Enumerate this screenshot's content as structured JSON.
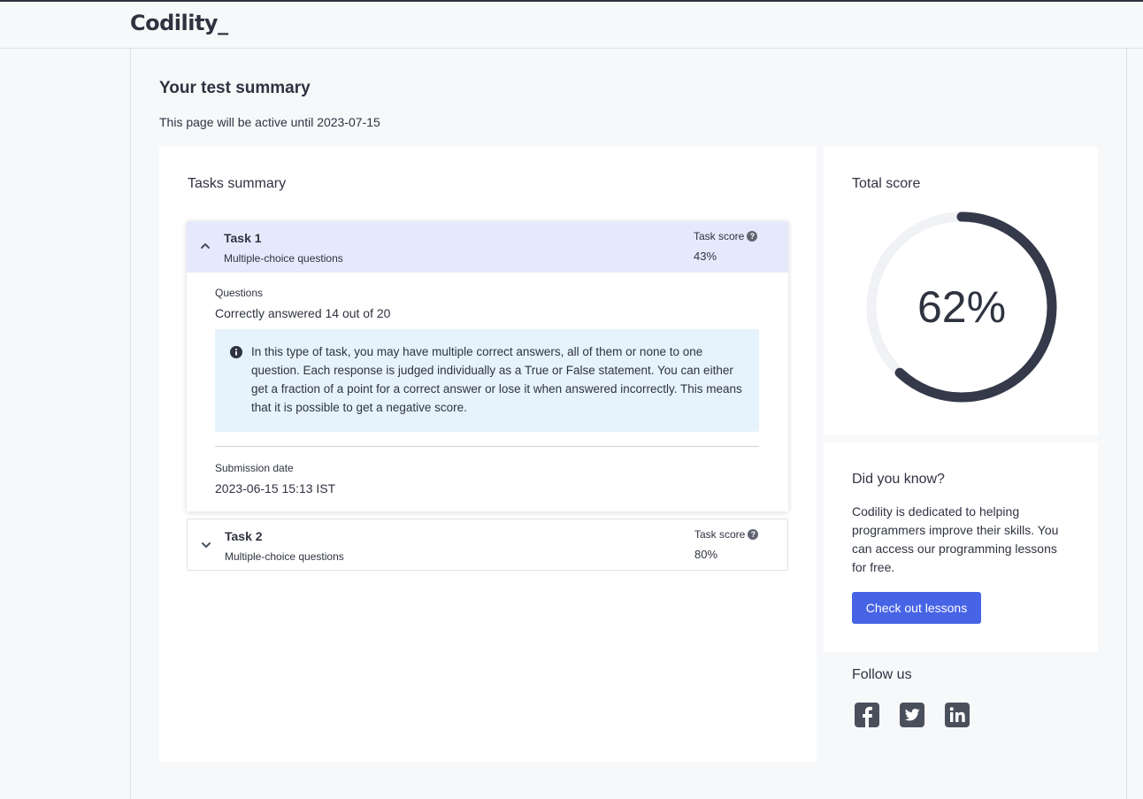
{
  "header": {
    "logo_text": "Codility_"
  },
  "page": {
    "title": "Your test summary",
    "subtitle": "This page will be active until 2023-07-15"
  },
  "tasks_summary": {
    "title": "Tasks summary",
    "tasks": [
      {
        "name": "Task 1",
        "type": "Multiple-choice questions",
        "score_label": "Task score",
        "score": "43%",
        "expanded": true,
        "questions_label": "Questions",
        "questions_value": "Correctly answered 14 out of 20",
        "info_text": "In this type of task, you may have multiple correct answers, all of them or none to one question. Each response is judged individually as a True or False statement. You can either get a fraction of a point for a correct answer or lose it when answered incorrectly. This means that it is possible to get a negative score.",
        "submission_label": "Submission date",
        "submission_value": "2023-06-15 15:13 IST"
      },
      {
        "name": "Task 2",
        "type": "Multiple-choice questions",
        "score_label": "Task score",
        "score": "80%",
        "expanded": false
      }
    ]
  },
  "total_score": {
    "title": "Total score",
    "value_text": "62%",
    "value": 62
  },
  "did_you_know": {
    "title": "Did you know?",
    "text": "Codility is dedicated to helping programmers improve their skills. You can access our programming lessons for free.",
    "button_label": "Check out lessons"
  },
  "follow": {
    "title": "Follow us",
    "icons": [
      "facebook-icon",
      "twitter-icon",
      "linkedin-icon"
    ]
  },
  "colors": {
    "accent": "#4763e6",
    "gauge_fill": "#353a4a",
    "gauge_track": "#f1f2f5",
    "task_header_active": "#e5e9fb",
    "info_bg": "#e6f3fc"
  }
}
